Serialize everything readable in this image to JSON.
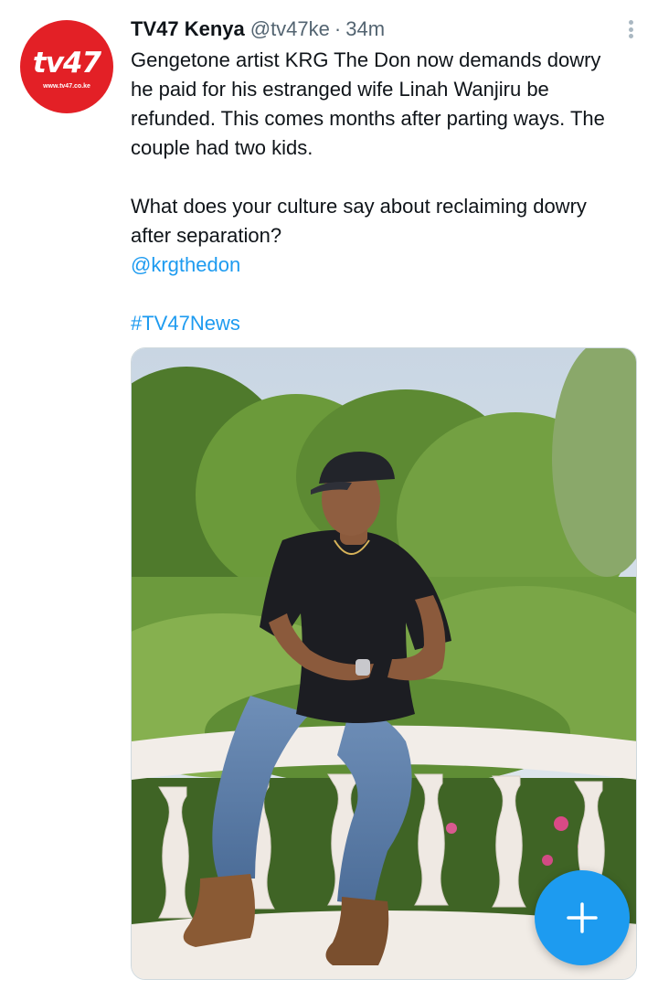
{
  "profile": {
    "avatar_logo": "tv47",
    "avatar_url": "www.tv47.co.ke"
  },
  "tweet": {
    "display_name": "TV47 Kenya",
    "handle": "@tv47ke",
    "separator": "·",
    "time": "34m",
    "text_lines": [
      "Gengetone artist KRG The Don now demands dowry",
      "he paid for his estranged wife Linah Wanjiru be",
      "refunded. This comes months after parting ways. The",
      "couple had two kids.",
      "What does your culture say about reclaiming dowry",
      "after separation?"
    ],
    "mention": "@krgthedon",
    "hashtag": "#TV47News"
  },
  "icons": {
    "more": "more-vertical-icon",
    "compose": "plus-icon"
  },
  "colors": {
    "brand_red": "#e32026",
    "link_blue": "#1d9bf0",
    "text": "#0f1419",
    "muted": "#536471"
  }
}
